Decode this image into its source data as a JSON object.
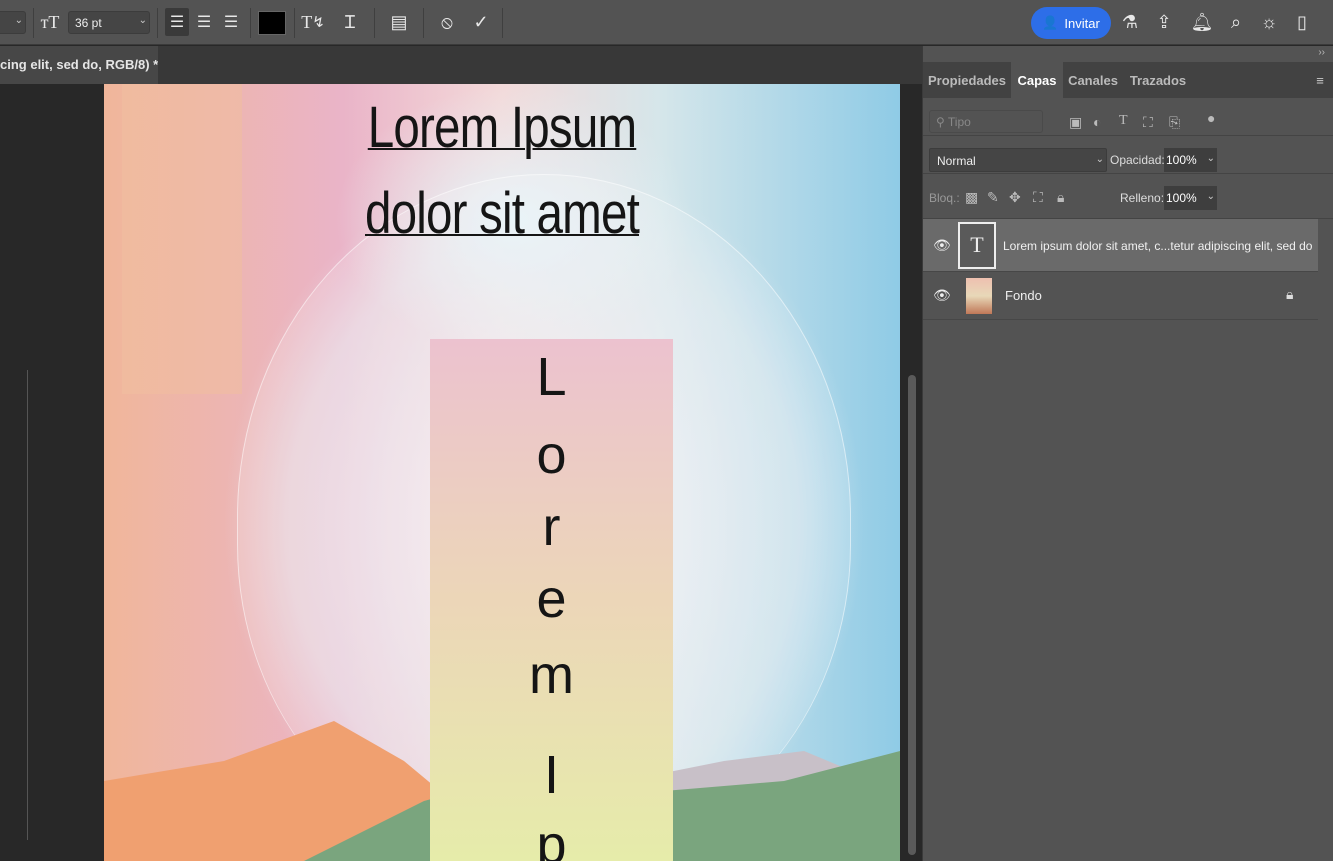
{
  "toolbar": {
    "font_size": "36pt",
    "font_size_label": "36 pt",
    "invite_label": "Invitar",
    "color_swatch": "#000000",
    "accent": "#2d6ee8"
  },
  "document": {
    "tab_title": "cing elit, sed do, RGB/8) *"
  },
  "canvas": {
    "title_line1": "Lorem Ipsum",
    "title_line2": "dolor sit amet",
    "vertical_letters": [
      "L",
      "o",
      "r",
      "e",
      "m",
      "I",
      "p"
    ]
  },
  "panel": {
    "tabs": [
      "Propiedades",
      "Capas",
      "Canales",
      "Trazados"
    ],
    "active_tab": "Capas",
    "filter_placeholder": "Tipo",
    "blend_mode": "Normal",
    "opacity_label": "Opacidad:",
    "opacity": "100%",
    "lock_label": "Bloq.:",
    "fill_label": "Relleno:",
    "fill": "100%",
    "layers": [
      {
        "name": "Lorem ipsum dolor sit amet, c...tetur adipiscing elit, sed do",
        "type": "text",
        "selected": true
      },
      {
        "name": "Fondo",
        "type": "image",
        "locked": true
      }
    ]
  }
}
